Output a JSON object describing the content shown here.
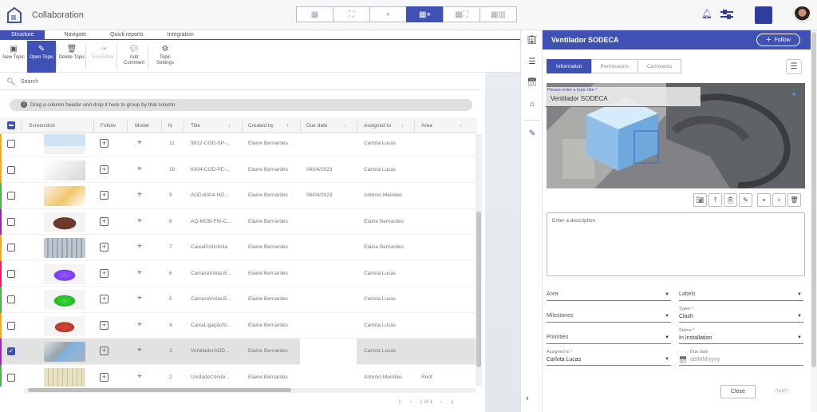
{
  "app": {
    "title": "Collaboration"
  },
  "view_modes": [
    "grid",
    "model",
    "target",
    "grid-target",
    "grid-model",
    "grid-split"
  ],
  "tabs": [
    "Structure",
    "Navigate",
    "Quick reports",
    "Integration"
  ],
  "toolbar": [
    {
      "label": "New Topic",
      "icon": "new-topic-icon"
    },
    {
      "label": "Open Topic",
      "icon": "pencil-icon"
    },
    {
      "label": "Delete Topic",
      "icon": "trash-icon"
    },
    {
      "label": "Exit Editor",
      "icon": "exit-icon"
    },
    {
      "label": "Add Comment",
      "icon": "comment-icon"
    },
    {
      "label": "Topic Settings",
      "icon": "settings-icon"
    }
  ],
  "search": {
    "placeholder": "Search"
  },
  "group_hint": "Drag a column header and drop it here to group by that column",
  "columns": [
    "Screenshot",
    "Follow",
    "Model",
    "N",
    "Title",
    "Created by",
    "Due date",
    "Assigned to",
    "Area"
  ],
  "rows": [
    {
      "n": "11",
      "title": "9812-COD-SP-...",
      "created": "Elaine Bernardes",
      "due": "",
      "assigned": "Carlota Lucas",
      "area": "",
      "stripe": "#f5a623",
      "thumb": "laptop",
      "selected": false
    },
    {
      "n": "10",
      "title": "8304-COD-PE-...",
      "created": "Elaine Bernardes",
      "due": "04/04/2023",
      "assigned": "Carlota Lucas",
      "area": "",
      "stripe": "#f5a623",
      "thumb": "calendar",
      "selected": false
    },
    {
      "n": "9",
      "title": "AUD-8304-HO...",
      "created": "Elaine Bernardes",
      "due": "06/04/2023",
      "assigned": "Antonio Meireles",
      "area": "",
      "stripe": "#4caf50",
      "thumb": "desk",
      "selected": false
    },
    {
      "n": "8",
      "title": "AQ-MOB-FIX-C...",
      "created": "Elaine Bernardes",
      "due": "",
      "assigned": "Elaine Bernardes",
      "area": "",
      "stripe": "#9c27b0",
      "thumb": "brown",
      "selected": false
    },
    {
      "n": "7",
      "title": "CaixaPortinhola",
      "created": "Elaine Bernardes",
      "due": "",
      "assigned": "Elaine Bernardes",
      "area": "",
      "stripe": "#f5a623",
      "thumb": "grey",
      "selected": false
    },
    {
      "n": "6",
      "title": "CamaraVisita-B...",
      "created": "Elaine Bernardes",
      "due": "",
      "assigned": "Carlota Lucas",
      "area": "",
      "stripe": "#e91e63",
      "thumb": "purple",
      "selected": false
    },
    {
      "n": "5",
      "title": "CamaraVisita-B...",
      "created": "Elaine Bernardes",
      "due": "",
      "assigned": "Carlota Lucas",
      "area": "",
      "stripe": "#4caf50",
      "thumb": "green",
      "selected": false
    },
    {
      "n": "4",
      "title": "CaixaLigaçãoSi...",
      "created": "Elaine Bernardes",
      "due": "",
      "assigned": "Carlota Lucas",
      "area": "",
      "stripe": "#f5a623",
      "thumb": "red",
      "selected": false
    },
    {
      "n": "3",
      "title": "VentiladorSOD...",
      "created": "Elaine Bernardes",
      "due": "",
      "assigned": "Carlota Lucas",
      "area": "",
      "stripe": "#9c27b0",
      "thumb": "blue",
      "selected": true
    },
    {
      "n": "2",
      "title": "UnidadeConde...",
      "created": "Elaine Bernardes",
      "due": "",
      "assigned": "Antonio Meireles",
      "area": "Roof",
      "stripe": "#4caf50",
      "thumb": "beige",
      "selected": false
    }
  ],
  "pager": {
    "text": "1 of 1"
  },
  "panel": {
    "title": "Ventilador SODECA",
    "follow_label": "Follow",
    "tabs": [
      "Information",
      "Permissions",
      "Comments"
    ],
    "title_field_label": "Please enter a topic title *",
    "title_value": "Ventilador SODECA",
    "description_placeholder": "Enter a description",
    "area_label": "Area",
    "labels_label": "Labels",
    "milestones_label": "Milestones",
    "types_label": "Types *",
    "types_value": "Clash",
    "priorities_label": "Priorities",
    "status_label": "Status *",
    "status_value": "In Installation",
    "assigned_label": "Assigned to *",
    "assigned_value": "Carlota Lucas",
    "duedate_label": "Due date",
    "duedate_placeholder": "dd/MM/yyyy",
    "close_label": "Close",
    "apply_label": "Apply"
  },
  "colors": {
    "accent": "#3f51b5"
  }
}
